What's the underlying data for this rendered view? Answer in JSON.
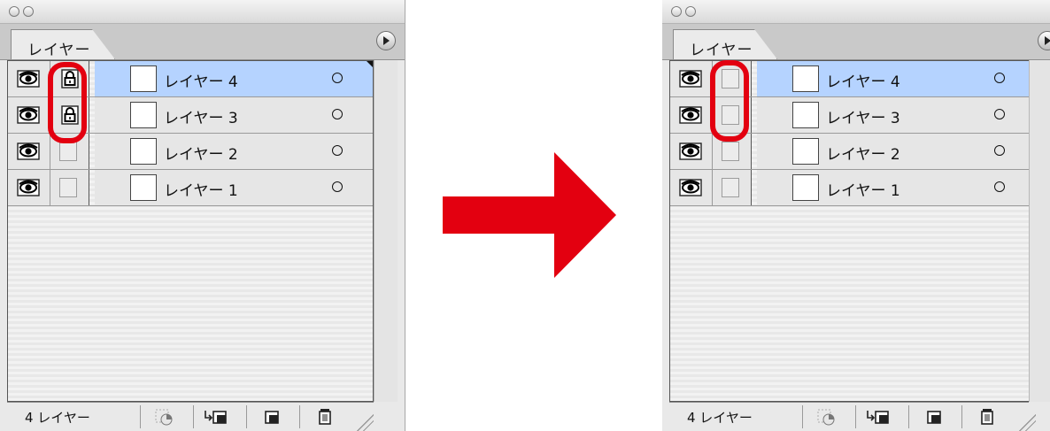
{
  "panels": [
    {
      "tab": "レイヤー",
      "layers": [
        {
          "name": "レイヤー 4",
          "visible": true,
          "locked": true,
          "selected": true
        },
        {
          "name": "レイヤー 3",
          "visible": true,
          "locked": true,
          "selected": false
        },
        {
          "name": "レイヤー 2",
          "visible": true,
          "locked": false,
          "selected": false
        },
        {
          "name": "レイヤー 1",
          "visible": true,
          "locked": false,
          "selected": false
        }
      ],
      "footer_count": "4 レイヤー"
    },
    {
      "tab": "レイヤー",
      "layers": [
        {
          "name": "レイヤー 4",
          "visible": true,
          "locked": false,
          "selected": true
        },
        {
          "name": "レイヤー 3",
          "visible": true,
          "locked": false,
          "selected": false
        },
        {
          "name": "レイヤー 2",
          "visible": true,
          "locked": false,
          "selected": false
        },
        {
          "name": "レイヤー 1",
          "visible": true,
          "locked": false,
          "selected": false
        }
      ],
      "footer_count": "4 レイヤー"
    }
  ],
  "colors": {
    "arrow": "#e30010",
    "highlight": "#e30010",
    "selection": "#b5d3ff"
  },
  "icons": {
    "visibility": "eye-icon",
    "lock": "lock-icon",
    "footer": [
      "make-clipping-mask-icon",
      "create-sublayer-icon",
      "create-new-layer-icon",
      "trash-icon"
    ]
  }
}
